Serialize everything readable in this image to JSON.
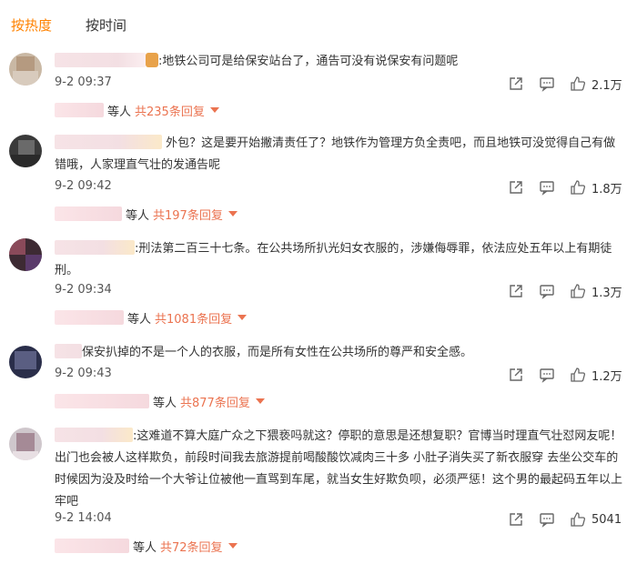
{
  "tabs": [
    {
      "label": "按热度",
      "active": true
    },
    {
      "label": "按时间",
      "active": false
    }
  ],
  "accent_color": "#ff8200",
  "reply_color": "#eb7350",
  "comments": [
    {
      "text": ":地铁公司可是给保安站台了，通告可没有说保安有问题呢",
      "time": "9-2 09:37",
      "likes": "2.1万",
      "reply_prefix": "等人",
      "reply_count": "共235条回复",
      "avatar_icon": "blurred-avatar"
    },
    {
      "text": "外包？这是要开始撇清责任了？地铁作为管理方负全责吧，而且地铁可没觉得自己有做错哦，人家理直气壮的发通告呢",
      "time": "9-2 09:42",
      "likes": "1.8万",
      "reply_prefix": "等人",
      "reply_count": "共197条回复",
      "avatar_icon": "blurred-avatar"
    },
    {
      "text": ":刑法第二百三十七条。在公共场所扒光妇女衣服的，涉嫌侮辱罪，依法应处五年以上有期徒刑。",
      "time": "9-2 09:34",
      "likes": "1.3万",
      "reply_prefix": "等人",
      "reply_count": "共1081条回复",
      "avatar_icon": "blurred-avatar"
    },
    {
      "text": "保安扒掉的不是一个人的衣服，而是所有女性在公共场所的尊严和安全感。",
      "time": "9-2 09:43",
      "likes": "1.2万",
      "reply_prefix": "等人",
      "reply_count": "共877条回复",
      "avatar_icon": "blurred-avatar"
    },
    {
      "text": ":这难道不算大庭广众之下猥亵吗就这？停职的意思是还想复职？官博当时理直气壮怼网友呢！出门也会被人这样欺负，前段时间我去旅游提前喝酸酸饮减肉三十多 小肚子消失买了新衣服穿 去坐公交车的时候因为没及时给一个大爷让位被他一直骂到车尾，就当女生好欺负呗，必须严惩！这个男的最起码五年以上牢吧",
      "time": "9-2 14:04",
      "likes": "5041",
      "reply_prefix": "等人",
      "reply_count": "共72条回复",
      "avatar_icon": "blurred-avatar"
    }
  ],
  "icons": {
    "share": "share-icon",
    "comment": "comment-icon",
    "like": "thumbs-up-icon",
    "caret": "caret-down-icon"
  }
}
